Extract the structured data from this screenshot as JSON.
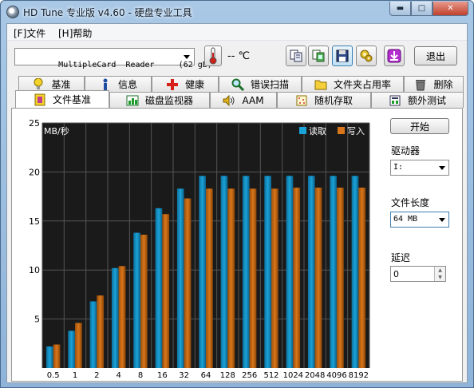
{
  "window": {
    "title": "HD Tune 专业版 v4.60 - 硬盘专业工具"
  },
  "menu": [
    {
      "label": "[F]文件"
    },
    {
      "label": "[H]帮助"
    }
  ],
  "toolbar": {
    "drive": "MultipleCard  Reader     (62 gB)",
    "temperature": "-- ℃",
    "exit_label": "退出",
    "icons": [
      "thermometer-icon",
      "copy-text-icon",
      "copy-screenshot-icon",
      "save-icon",
      "options-icon",
      "download-icon"
    ]
  },
  "tabs_row1": [
    {
      "label": "基准",
      "icon": "benchmark-icon"
    },
    {
      "label": "信息",
      "icon": "info-icon"
    },
    {
      "label": "健康",
      "icon": "health-icon"
    },
    {
      "label": "错误扫描",
      "icon": "error-scan-icon"
    },
    {
      "label": "文件夹占用率",
      "icon": "folder-usage-icon"
    },
    {
      "label": "删除",
      "icon": "erase-icon"
    }
  ],
  "tabs_row2": [
    {
      "label": "文件基准",
      "icon": "file-benchmark-icon",
      "active": true
    },
    {
      "label": "磁盘监视器",
      "icon": "disk-monitor-icon"
    },
    {
      "label": "AAM",
      "icon": "aam-icon"
    },
    {
      "label": "随机存取",
      "icon": "random-access-icon"
    },
    {
      "label": "额外测试",
      "icon": "extra-tests-icon"
    }
  ],
  "controls": {
    "start_label": "开始",
    "drive_label": "驱动器",
    "drive_value": "I:",
    "filesize_label": "文件长度",
    "filesize_value": "64 MB",
    "delay_label": "延迟",
    "delay_value": "0"
  },
  "chart_data": {
    "type": "bar",
    "ylabel": "MB/秒",
    "ylim": [
      0,
      25
    ],
    "yticks": [
      5,
      10,
      15,
      20,
      25
    ],
    "categories": [
      "0.5",
      "1",
      "2",
      "4",
      "8",
      "16",
      "32",
      "64",
      "128",
      "256",
      "512",
      "1024",
      "2048",
      "4096",
      "8192"
    ],
    "series": [
      {
        "name": "读取",
        "color": "#1aa3d9",
        "values": [
          2.2,
          3.8,
          6.8,
          10.2,
          13.8,
          16.3,
          18.3,
          19.6,
          19.6,
          19.6,
          19.6,
          19.6,
          19.6,
          19.6,
          19.6
        ]
      },
      {
        "name": "写入",
        "color": "#d9761a",
        "values": [
          2.4,
          4.6,
          7.4,
          10.4,
          13.6,
          15.7,
          17.3,
          18.3,
          18.3,
          18.3,
          18.3,
          18.4,
          18.4,
          18.4,
          18.4
        ]
      }
    ],
    "legend_position": "top-right",
    "background": "#1a1a1a",
    "grid": true
  }
}
